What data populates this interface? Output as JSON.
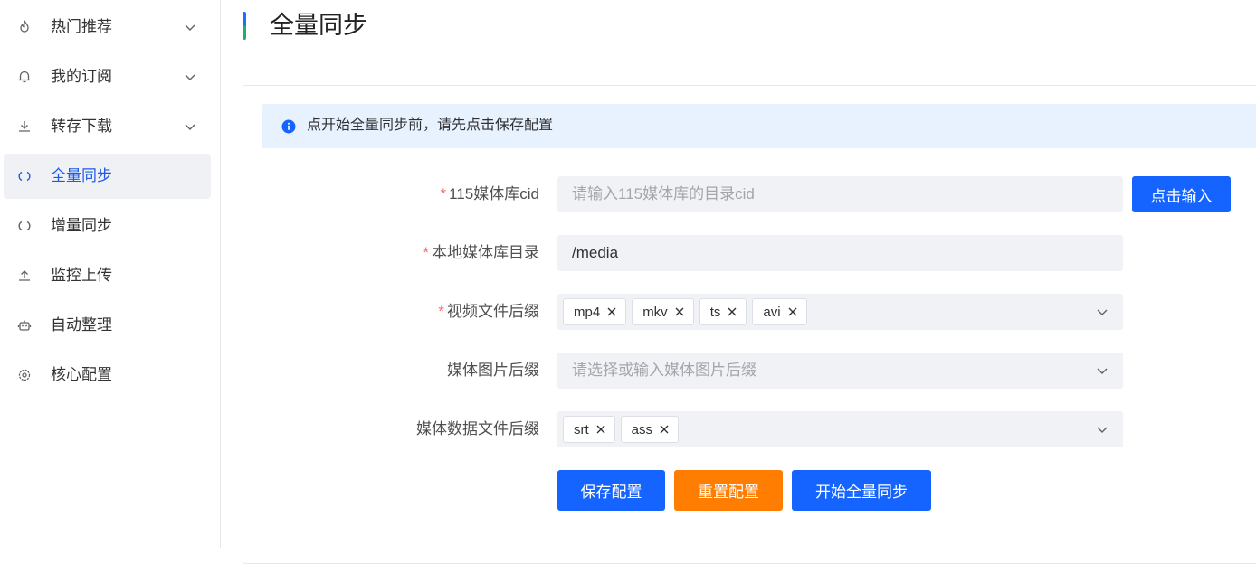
{
  "sidebar": {
    "items": [
      {
        "label": "热门推荐",
        "icon": "fire-icon",
        "has_chevron": true
      },
      {
        "label": "我的订阅",
        "icon": "bell-icon",
        "has_chevron": true
      },
      {
        "label": "转存下载",
        "icon": "download-icon",
        "has_chevron": true
      },
      {
        "label": "全量同步",
        "icon": "sync-icon",
        "has_chevron": false,
        "active": true
      },
      {
        "label": "增量同步",
        "icon": "sync-icon",
        "has_chevron": false
      },
      {
        "label": "监控上传",
        "icon": "upload-icon",
        "has_chevron": false
      },
      {
        "label": "自动整理",
        "icon": "robot-icon",
        "has_chevron": false
      },
      {
        "label": "核心配置",
        "icon": "gear-icon",
        "has_chevron": false
      }
    ]
  },
  "page": {
    "title": "全量同步"
  },
  "alert": {
    "text": "点开始全量同步前，请先点击保存配置",
    "icon": "info-icon"
  },
  "form": {
    "cid": {
      "label": "115媒体库cid",
      "required": true,
      "placeholder": "请输入115媒体库的目录cid",
      "value": "",
      "button_label": "点击输入"
    },
    "local_dir": {
      "label": "本地媒体库目录",
      "required": true,
      "value": "/media"
    },
    "video_ext": {
      "label": "视频文件后缀",
      "required": true,
      "tags": [
        "mp4",
        "mkv",
        "ts",
        "avi"
      ]
    },
    "image_ext": {
      "label": "媒体图片后缀",
      "required": false,
      "placeholder": "请选择或输入媒体图片后缀"
    },
    "meta_ext": {
      "label": "媒体数据文件后缀",
      "required": false,
      "tags": [
        "srt",
        "ass"
      ]
    }
  },
  "actions": {
    "save_label": "保存配置",
    "reset_label": "重置配置",
    "start_label": "开始全量同步"
  },
  "colors": {
    "primary": "#1664ff",
    "warning": "#ff7d00",
    "active_text": "#1e5ae6",
    "required_star": "#f56c6c",
    "alert_bg": "#e8f1fe"
  }
}
